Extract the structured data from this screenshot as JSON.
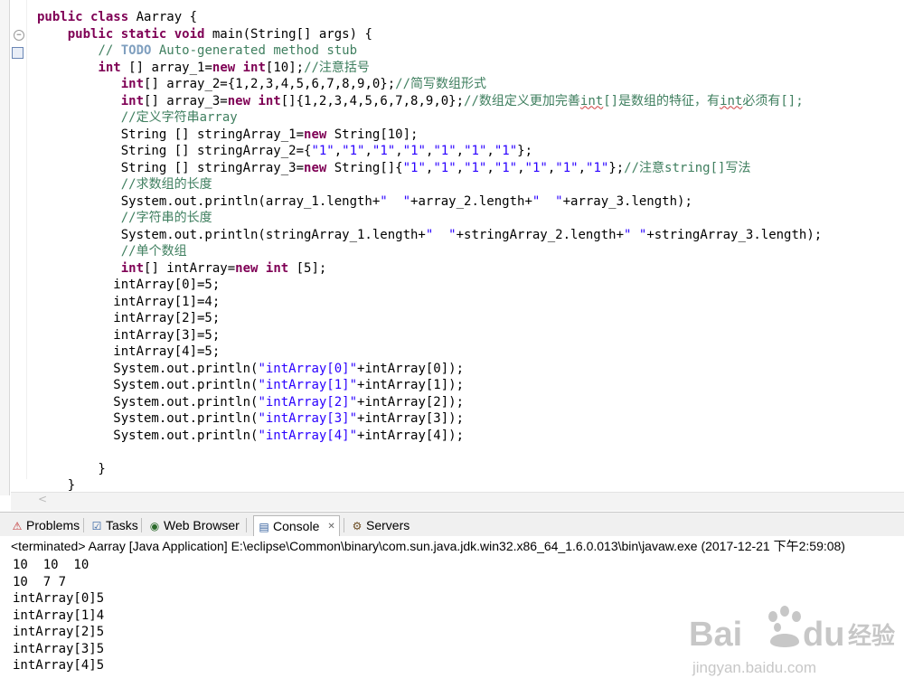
{
  "editor": {
    "lines": [
      [
        {
          "t": "public class ",
          "c": "kw"
        },
        {
          "t": "Aarray {"
        }
      ],
      [
        {
          "t": "    "
        },
        {
          "t": "public static void ",
          "c": "kw"
        },
        {
          "t": "main(String[] args) {"
        }
      ],
      [
        {
          "t": "        "
        },
        {
          "t": "// ",
          "c": "cm"
        },
        {
          "t": "TODO",
          "c": "todo"
        },
        {
          "t": " Auto-generated method stub",
          "c": "cm"
        }
      ],
      [
        {
          "t": "        "
        },
        {
          "t": "int",
          "c": "kw"
        },
        {
          "t": " [] array_1="
        },
        {
          "t": "new int",
          "c": "kw"
        },
        {
          "t": "[10];"
        },
        {
          "t": "//注意括号",
          "c": "cm"
        }
      ],
      [
        {
          "t": "           "
        },
        {
          "t": "int",
          "c": "kw"
        },
        {
          "t": "[] array_2={1,2,3,4,5,6,7,8,9,0};"
        },
        {
          "t": "//简写数组形式",
          "c": "cm"
        }
      ],
      [
        {
          "t": "           "
        },
        {
          "t": "int",
          "c": "kw"
        },
        {
          "t": "[] array_3="
        },
        {
          "t": "new int",
          "c": "kw"
        },
        {
          "t": "[]{1,2,3,4,5,6,7,8,9,0};"
        },
        {
          "t": "//数组定义更加完善",
          "c": "cm"
        },
        {
          "t": "int",
          "c": "cm sq"
        },
        {
          "t": "[]是数组的特征，有",
          "c": "cm"
        },
        {
          "t": "int",
          "c": "cm sq"
        },
        {
          "t": "必须有[];",
          "c": "cm"
        }
      ],
      [
        {
          "t": "           "
        },
        {
          "t": "//定义字符串array",
          "c": "cm"
        }
      ],
      [
        {
          "t": "           String [] stringArray_1="
        },
        {
          "t": "new",
          "c": "kw"
        },
        {
          "t": " String[10];"
        }
      ],
      [
        {
          "t": "           String [] stringArray_2={"
        },
        {
          "t": "\"1\"",
          "c": "st"
        },
        {
          "t": ","
        },
        {
          "t": "\"1\"",
          "c": "st"
        },
        {
          "t": ","
        },
        {
          "t": "\"1\"",
          "c": "st"
        },
        {
          "t": ","
        },
        {
          "t": "\"1\"",
          "c": "st"
        },
        {
          "t": ","
        },
        {
          "t": "\"1\"",
          "c": "st"
        },
        {
          "t": ","
        },
        {
          "t": "\"1\"",
          "c": "st"
        },
        {
          "t": ","
        },
        {
          "t": "\"1\"",
          "c": "st"
        },
        {
          "t": "};"
        }
      ],
      [
        {
          "t": "           String [] stringArray_3="
        },
        {
          "t": "new",
          "c": "kw"
        },
        {
          "t": " String[]{"
        },
        {
          "t": "\"1\"",
          "c": "st"
        },
        {
          "t": ","
        },
        {
          "t": "\"1\"",
          "c": "st"
        },
        {
          "t": ","
        },
        {
          "t": "\"1\"",
          "c": "st"
        },
        {
          "t": ","
        },
        {
          "t": "\"1\"",
          "c": "st"
        },
        {
          "t": ","
        },
        {
          "t": "\"1\"",
          "c": "st"
        },
        {
          "t": ","
        },
        {
          "t": "\"1\"",
          "c": "st"
        },
        {
          "t": ","
        },
        {
          "t": "\"1\"",
          "c": "st"
        },
        {
          "t": "};"
        },
        {
          "t": "//注意string[]写法",
          "c": "cm"
        }
      ],
      [
        {
          "t": "           "
        },
        {
          "t": "//求数组的长度",
          "c": "cm"
        }
      ],
      [
        {
          "t": "           System.out.println(array_1.length+"
        },
        {
          "t": "\"  \"",
          "c": "st"
        },
        {
          "t": "+array_2.length+"
        },
        {
          "t": "\"  \"",
          "c": "st"
        },
        {
          "t": "+array_3.length);"
        }
      ],
      [
        {
          "t": "           "
        },
        {
          "t": "//字符串的长度",
          "c": "cm"
        }
      ],
      [
        {
          "t": "           System.out.println(stringArray_1.length+"
        },
        {
          "t": "\"  \"",
          "c": "st"
        },
        {
          "t": "+stringArray_2.length+"
        },
        {
          "t": "\" \"",
          "c": "st"
        },
        {
          "t": "+stringArray_3.length);"
        }
      ],
      [
        {
          "t": "           "
        },
        {
          "t": "//单个数组",
          "c": "cm"
        }
      ],
      [
        {
          "t": "           "
        },
        {
          "t": "int",
          "c": "kw"
        },
        {
          "t": "[] intArray="
        },
        {
          "t": "new int",
          "c": "kw"
        },
        {
          "t": " [5];"
        }
      ],
      [
        {
          "t": "          intArray[0]=5;"
        }
      ],
      [
        {
          "t": "          intArray[1]=4;"
        }
      ],
      [
        {
          "t": "          intArray[2]=5;"
        }
      ],
      [
        {
          "t": "          intArray[3]=5;"
        }
      ],
      [
        {
          "t": "          intArray[4]=5;"
        }
      ],
      [
        {
          "t": "          System.out.println("
        },
        {
          "t": "\"intArray[0]\"",
          "c": "st"
        },
        {
          "t": "+intArray[0]);"
        }
      ],
      [
        {
          "t": "          System.out.println("
        },
        {
          "t": "\"intArray[1]\"",
          "c": "st"
        },
        {
          "t": "+intArray[1]);"
        }
      ],
      [
        {
          "t": "          System.out.println("
        },
        {
          "t": "\"intArray[2]\"",
          "c": "st"
        },
        {
          "t": "+intArray[2]);"
        }
      ],
      [
        {
          "t": "          System.out.println("
        },
        {
          "t": "\"intArray[3]\"",
          "c": "st"
        },
        {
          "t": "+intArray[3]);"
        }
      ],
      [
        {
          "t": "          System.out.println("
        },
        {
          "t": "\"intArray[4]\"",
          "c": "st"
        },
        {
          "t": "+intArray[4]);"
        }
      ],
      [
        {
          "t": ""
        }
      ],
      [
        {
          "t": "        }"
        }
      ],
      [
        {
          "t": "    }"
        }
      ]
    ]
  },
  "tabs": [
    {
      "label": "Problems",
      "icon": "problems-icon",
      "active": false
    },
    {
      "label": "Tasks",
      "icon": "tasks-icon",
      "active": false
    },
    {
      "label": "Web Browser",
      "icon": "web-browser-icon",
      "active": false
    },
    {
      "label": "Console",
      "icon": "console-icon",
      "active": true
    },
    {
      "label": "Servers",
      "icon": "servers-icon",
      "active": false
    }
  ],
  "console": {
    "header": "<terminated> Aarray [Java Application] E:\\eclipse\\Common\\binary\\com.sun.java.jdk.win32.x86_64_1.6.0.013\\bin\\javaw.exe (2017-12-21 下午2:59:08)",
    "output": [
      "10  10  10",
      "10  7 7",
      "intArray[0]5",
      "intArray[1]4",
      "intArray[2]5",
      "intArray[3]5",
      "intArray[4]5"
    ]
  },
  "watermark": {
    "brand": "Bai",
    "brand2": "du",
    "cn": "经验",
    "url": "jingyan.baidu.com"
  },
  "colors": {
    "keyword": "#7f0055",
    "comment": "#3f7f5f",
    "string": "#2a00ff",
    "todo": "#7f9fbf"
  }
}
